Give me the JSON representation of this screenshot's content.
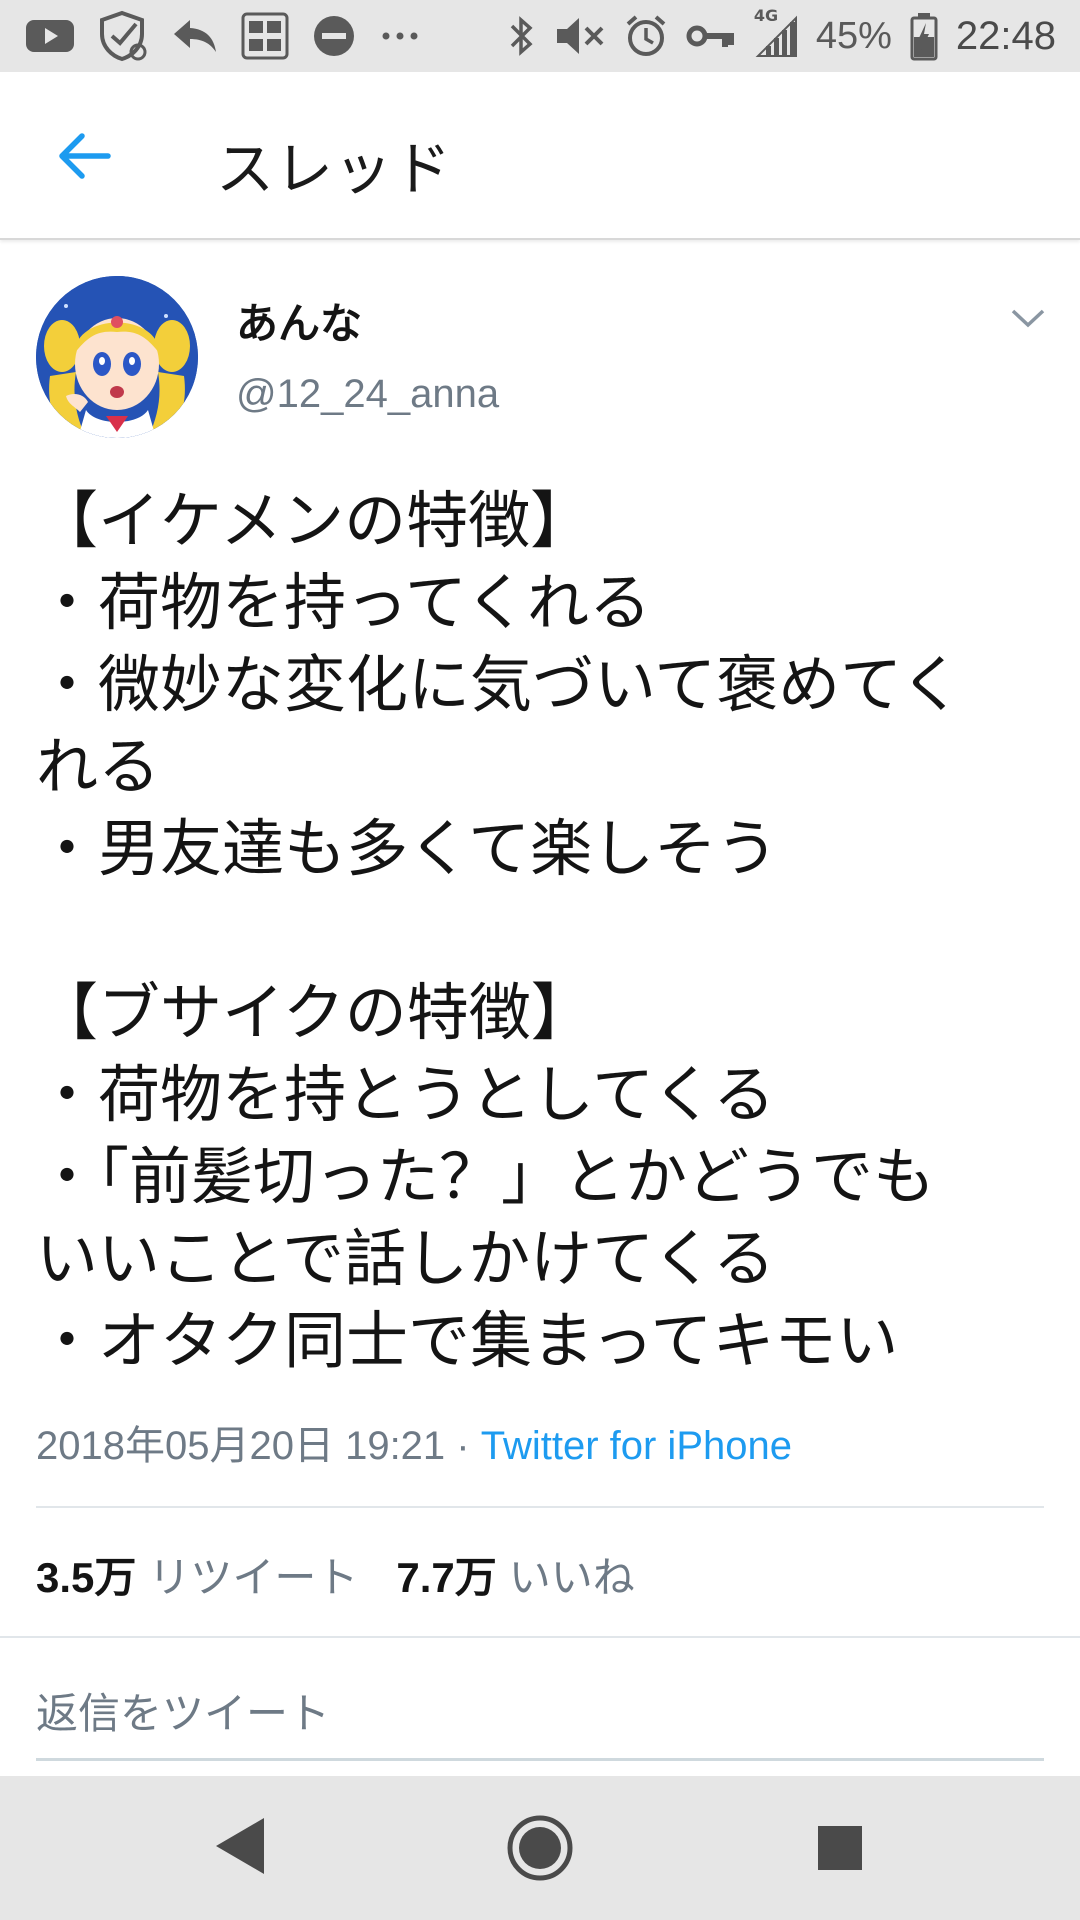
{
  "status_bar": {
    "icons_left": [
      "youtube-icon",
      "shield-refresh-icon",
      "reply-arrow-icon",
      "dictionary-app-icon",
      "do-not-disturb-icon",
      "more-dots-icon"
    ],
    "icons_right": [
      "bluetooth-icon",
      "muted-volume-icon",
      "alarm-icon",
      "key-icon",
      "signal-4g-icon",
      "battery-icon"
    ],
    "network_label": "4G",
    "battery": "45%",
    "time": "22:48"
  },
  "header": {
    "title": "スレッド"
  },
  "tweet": {
    "display_name": "あんな",
    "handle": "@12_24_anna",
    "lines": [
      "【イケメンの特徴】",
      "・荷物を持ってくれる",
      "・微妙な変化に気づいて褒めてく",
      "れる",
      "・男友達も多くて楽しそう",
      "",
      "【ブサイクの特徴】",
      "・荷物を持とうとしてくる",
      "・「前髪切った？」とかどうでも",
      "いいことで話しかけてくる",
      "・オタク同士で集まってキモい"
    ],
    "timestamp": "2018年05月20日 19:21",
    "separator": " · ",
    "source": "Twitter for iPhone",
    "retweets_count": "3.5万",
    "retweets_label": "リツイート",
    "likes_count": "7.7万",
    "likes_label": "いいね"
  },
  "reply": {
    "placeholder": "返信をツイート"
  },
  "colors": {
    "accent": "#1d9bf0",
    "secondary_text": "#6e7a86",
    "bars": "#e6e6e6"
  }
}
